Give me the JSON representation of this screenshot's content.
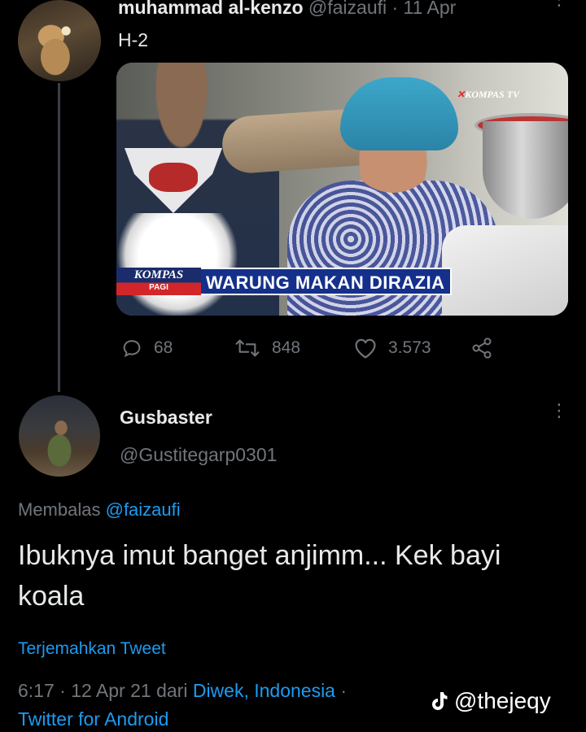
{
  "tweet1": {
    "display_name": "muhammad al-kenzo",
    "handle_time": "@faizaufi · 11 Apr",
    "text": "H-2",
    "media": {
      "channel_logo": "KOMPAS TV",
      "show_logo_top": "KOMPAS",
      "show_logo_bottom": "PAGI",
      "headline": "WARUNG MAKAN DIRAZIA"
    },
    "actions": {
      "replies": "68",
      "retweets": "848",
      "likes": "3.573"
    }
  },
  "tweet2": {
    "display_name": "Gusbaster",
    "handle": "@Gustitegarp0301",
    "reply_prefix": "Membalas",
    "reply_mention": "@faizaufi",
    "text": "Ibuknya imut banget anjimm... Kek bayi koala",
    "translate_label": "Terjemahkan Tweet",
    "timestamp": "6:17 · 12 Apr 21",
    "from_label": "dari",
    "location": "Diwek, Indonesia",
    "separator": "·",
    "client": "Twitter for Android"
  },
  "watermark": "@thejeqy",
  "icons": [
    "reply-icon",
    "retweet-icon",
    "like-icon",
    "share-icon",
    "more-icon",
    "tiktok-icon"
  ],
  "colors": {
    "background": "#000000",
    "link": "#1d9bf0",
    "muted": "#71767b",
    "text": "#e7e9ea"
  }
}
